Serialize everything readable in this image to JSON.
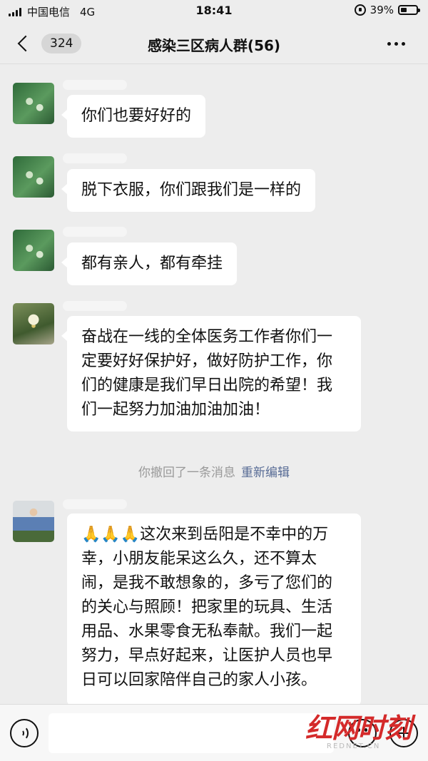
{
  "status_bar": {
    "carrier": "中国电信",
    "network": "4G",
    "time": "18:41",
    "battery": "39%",
    "battery_level": 0.39
  },
  "nav": {
    "unread_count": "324",
    "title": "感染三区病人群(56)"
  },
  "messages": [
    {
      "avatar": "flower-avatar",
      "text": "你们也要好好的"
    },
    {
      "avatar": "flower-avatar",
      "text": "脱下衣服，你们跟我们是一样的"
    },
    {
      "avatar": "flower-avatar",
      "text": "都有亲人，都有牵挂"
    },
    {
      "avatar": "lily-avatar",
      "text": "奋战在一线的全体医务工作者你们一定要好好保护好，做好防护工作，你们的健康是我们早日出院的希望！我们一起努力加油加油加油！"
    },
    {
      "avatar": "child-photo-avatar",
      "text": "🙏🙏🙏这次来到岳阳是不幸中的万幸，小朋友能呆这么久，还不算太闹，是我不敢想象的，多亏了您们的的关心与照顾！把家里的玩具、生活用品、水果零食无私奉献。我们一起努力，早点好起来，让医护人员也早日可以回家陪伴自己的家人小孩。"
    }
  ],
  "recall_notice": {
    "text": "你撤回了一条消息",
    "action": "重新编辑"
  },
  "watermark": {
    "logo": "红网时刻",
    "subtext": "REDNET.CN"
  },
  "icons": [
    "back-icon",
    "more-icon",
    "voice-icon",
    "emoji-icon",
    "add-icon",
    "lock-rotation-icon",
    "battery-icon",
    "signal-icon"
  ]
}
